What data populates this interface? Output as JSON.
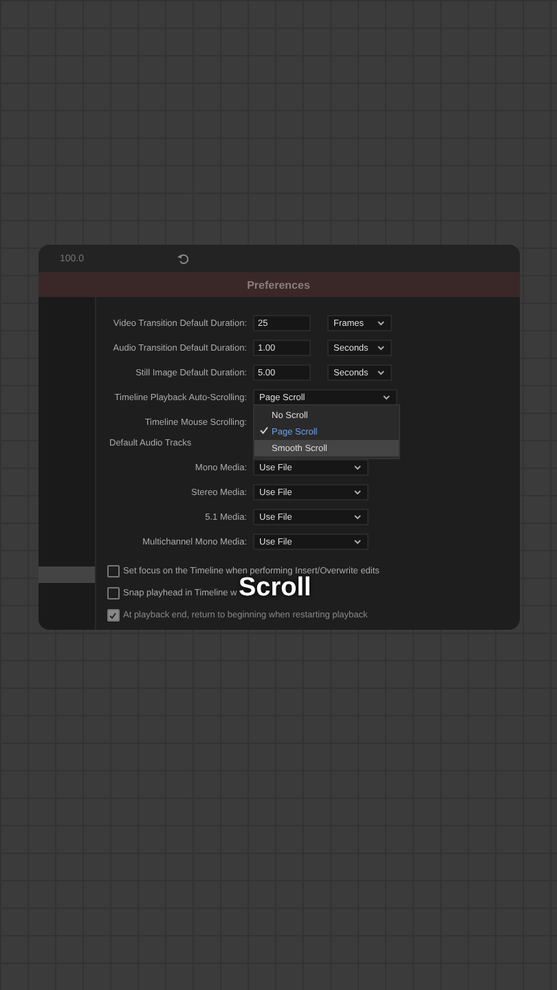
{
  "panel_strip": {
    "value": "100.0"
  },
  "window": {
    "title": "Preferences"
  },
  "sidebar": {
    "items": [
      {
        "selected": true
      }
    ]
  },
  "duration_rows": [
    {
      "label": "Video Transition Default Duration:",
      "value": "25",
      "unit": "Frames"
    },
    {
      "label": "Audio Transition Default Duration:",
      "value": "1.00",
      "unit": "Seconds"
    },
    {
      "label": "Still Image Default Duration:",
      "value": "5.00",
      "unit": "Seconds"
    }
  ],
  "auto_scrolling": {
    "label": "Timeline Playback Auto-Scrolling:",
    "value": "Page Scroll",
    "options": [
      {
        "label": "No Scroll",
        "selected": false,
        "hovered": false
      },
      {
        "label": "Page Scroll",
        "selected": true,
        "hovered": false
      },
      {
        "label": "Smooth Scroll",
        "selected": false,
        "hovered": true
      }
    ]
  },
  "mouse_scrolling": {
    "label": "Timeline Mouse Scrolling:"
  },
  "audio_tracks": {
    "title": "Default Audio Tracks",
    "rows": [
      {
        "label": "Mono Media:",
        "value": "Use File"
      },
      {
        "label": "Stereo Media:",
        "value": "Use File"
      },
      {
        "label": "5.1 Media:",
        "value": "Use File"
      },
      {
        "label": "Multichannel Mono Media:",
        "value": "Use File"
      }
    ]
  },
  "checkboxes": [
    {
      "label": "Set focus on the Timeline when performing Insert/Overwrite edits",
      "checked": false
    },
    {
      "label": "Snap playhead in Timeline w",
      "checked": false
    },
    {
      "label": "At playback end, return to beginning when restarting playback",
      "checked": true
    }
  ],
  "caption": "Scroll"
}
